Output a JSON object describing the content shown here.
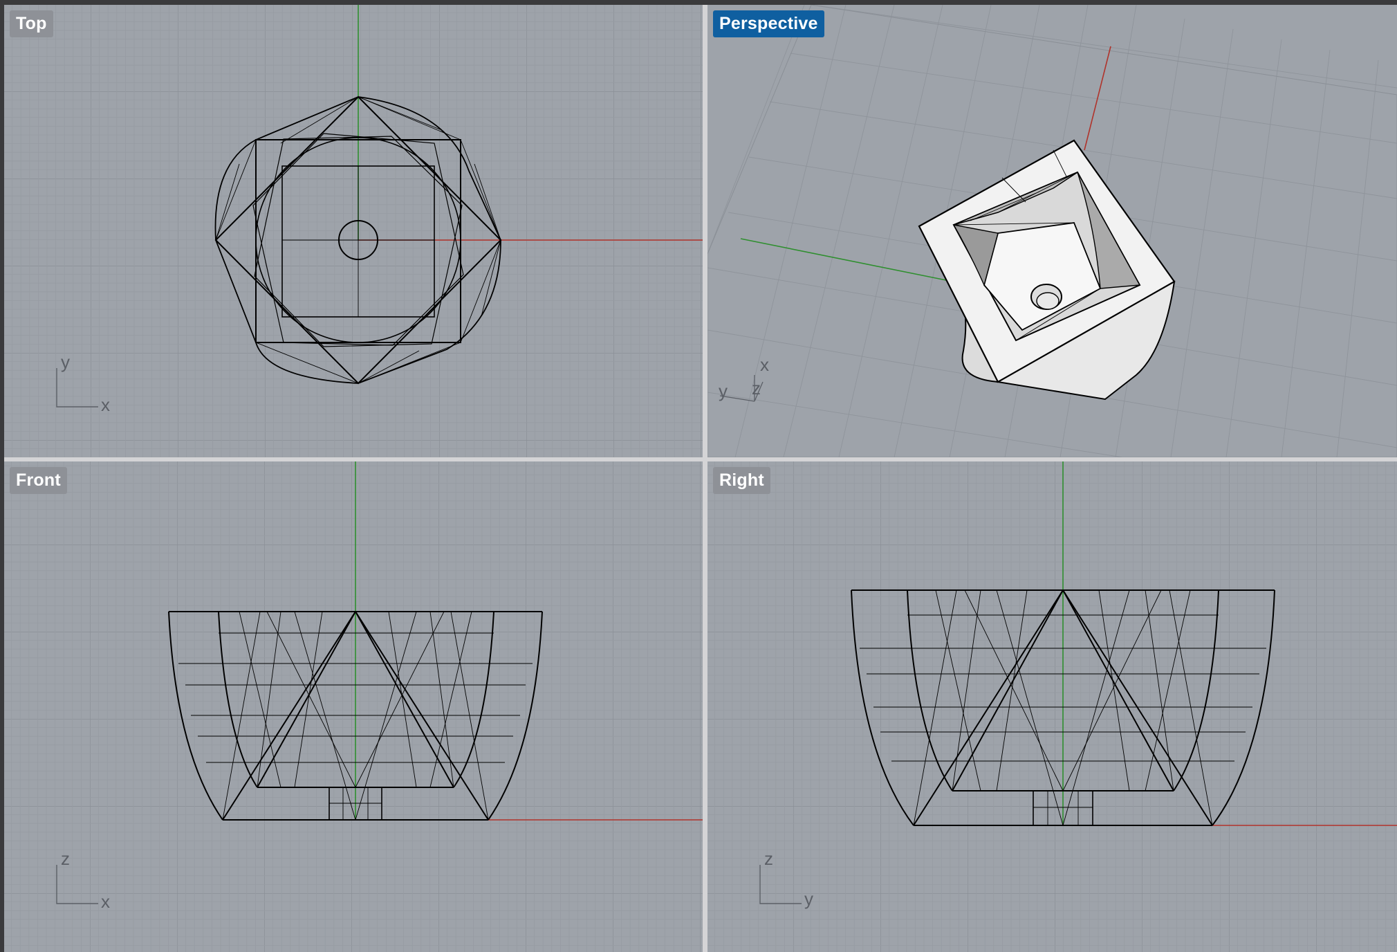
{
  "viewports": {
    "top": {
      "label": "Top",
      "active": false,
      "axes": {
        "vertical": "y",
        "horizontal": "x"
      }
    },
    "perspective": {
      "label": "Perspective",
      "active": true,
      "axes": {
        "a": "x",
        "b": "y",
        "c": "z"
      }
    },
    "front": {
      "label": "Front",
      "active": false,
      "axes": {
        "vertical": "z",
        "horizontal": "x"
      }
    },
    "right": {
      "label": "Right",
      "active": false,
      "axes": {
        "vertical": "z",
        "horizontal": "y"
      }
    }
  },
  "colors": {
    "viewport_bg": "#9ea3aa",
    "grid_minor": "#959aa1",
    "grid_major": "#8a8f96",
    "x_axis": "#b0332b",
    "y_axis": "#2f8f2f",
    "wire": "#000000",
    "active_label": "#0f5fa0",
    "inactive_label": "#8e9197",
    "divider": "#d4d4d6"
  }
}
